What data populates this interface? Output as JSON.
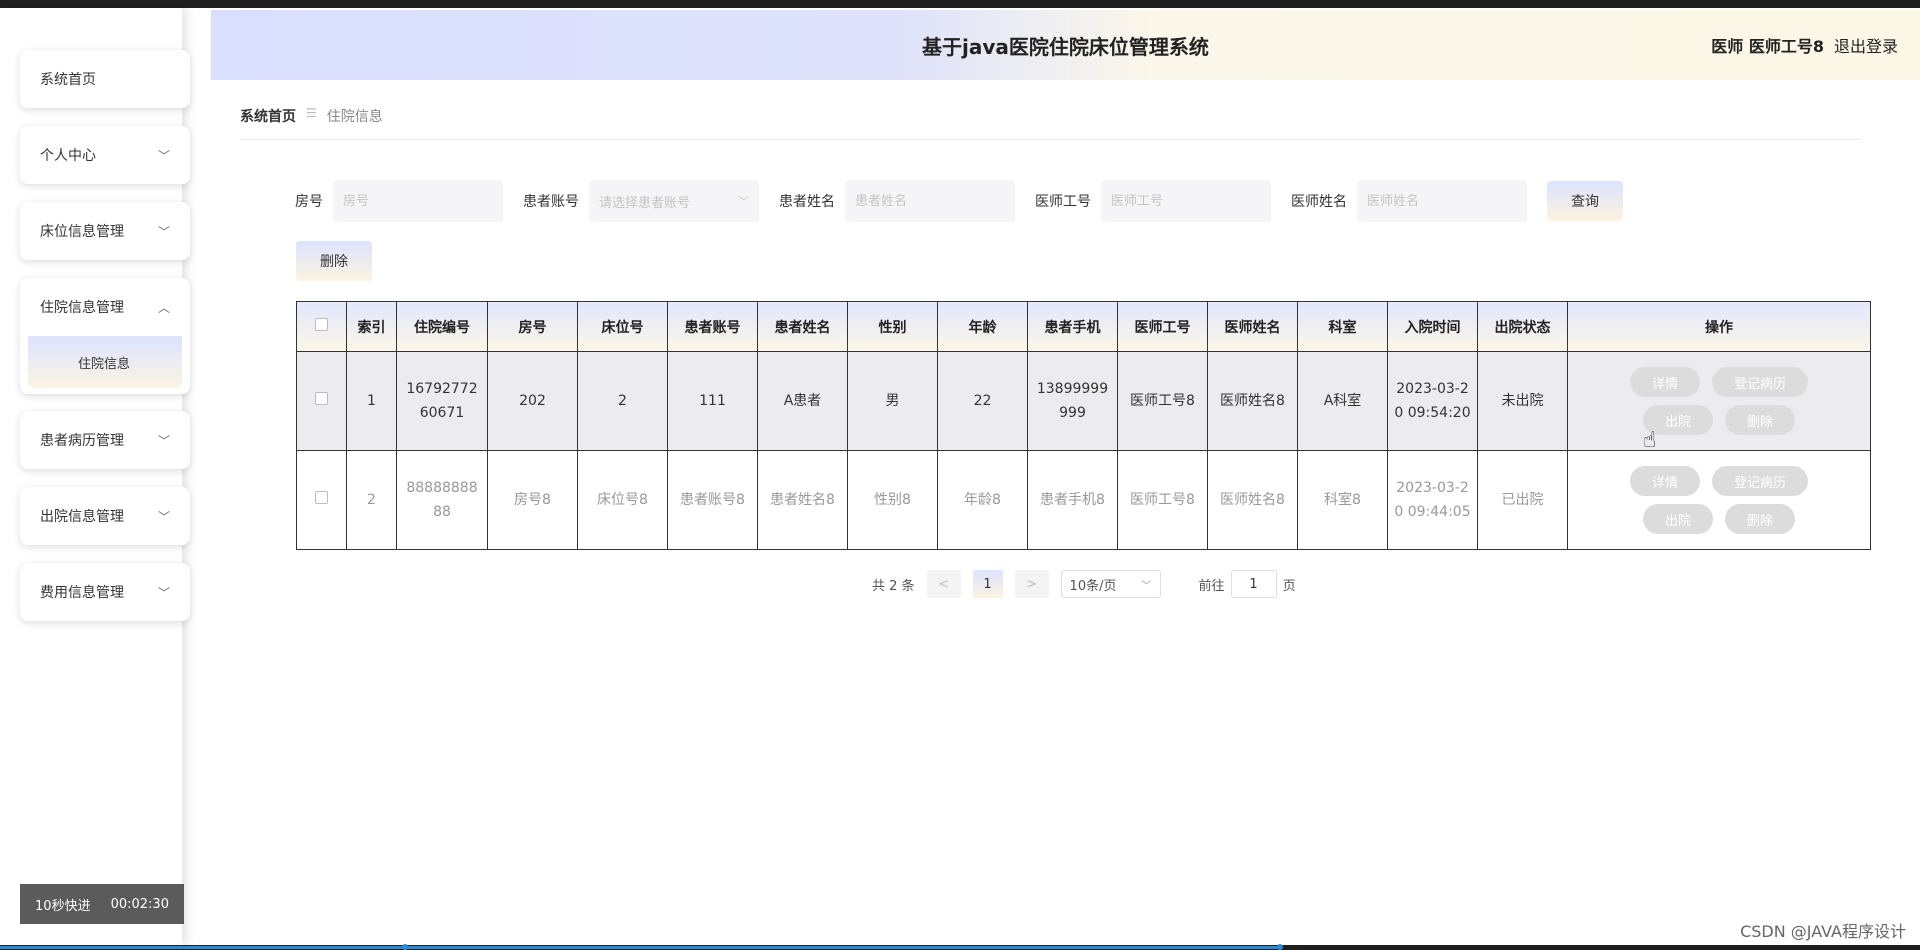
{
  "header": {
    "title": "基于java医院住院床位管理系统",
    "user": "医师 医师工号8",
    "logout": "退出登录"
  },
  "sidebar": {
    "items": [
      {
        "label": "系统首页",
        "icon": "none"
      },
      {
        "label": "个人中心",
        "icon": "chevron-down-icon"
      },
      {
        "label": "床位信息管理",
        "icon": "chevron-down-icon"
      },
      {
        "label": "住院信息管理",
        "icon": "chevron-up-icon",
        "sub": "住院信息"
      },
      {
        "label": "患者病历管理",
        "icon": "chevron-down-icon"
      },
      {
        "label": "出院信息管理",
        "icon": "chevron-down-icon"
      },
      {
        "label": "费用信息管理",
        "icon": "chevron-down-icon"
      }
    ]
  },
  "video": {
    "skip": "10秒快进",
    "time": "00:02:30"
  },
  "breadcrumb": {
    "home": "系统首页",
    "current": "住院信息"
  },
  "search": {
    "room": {
      "label": "房号",
      "placeholder": "房号"
    },
    "account": {
      "label": "患者账号",
      "placeholder": "请选择患者账号"
    },
    "patient_name": {
      "label": "患者姓名",
      "placeholder": "患者姓名"
    },
    "doctor_id": {
      "label": "医师工号",
      "placeholder": "医师工号"
    },
    "doctor_name": {
      "label": "医师姓名",
      "placeholder": "医师姓名"
    },
    "query_button": "查询"
  },
  "delete_button": "删除",
  "table": {
    "headers": [
      "索引",
      "住院编号",
      "房号",
      "床位号",
      "患者账号",
      "患者姓名",
      "性别",
      "年龄",
      "患者手机",
      "医师工号",
      "医师姓名",
      "科室",
      "入院时间",
      "出院状态",
      "操作"
    ],
    "rows": [
      {
        "index": "1",
        "inpatient_no": "1679277260671",
        "room": "202",
        "bed": "2",
        "account": "111",
        "name": "A患者",
        "gender": "男",
        "age": "22",
        "phone": "13899999999",
        "doctor_id": "医师工号8",
        "doctor_name": "医师姓名8",
        "dept": "A科室",
        "admit_time": "2023-03-20 09:54:20",
        "status": "未出院"
      },
      {
        "index": "2",
        "inpatient_no": "8888888888",
        "room": "房号8",
        "bed": "床位号8",
        "account": "患者账号8",
        "name": "患者姓名8",
        "gender": "性别8",
        "age": "年龄8",
        "phone": "患者手机8",
        "doctor_id": "医师工号8",
        "doctor_name": "医师姓名8",
        "dept": "科室8",
        "admit_time": "2023-03-20 09:44:05",
        "status": "已出院"
      }
    ],
    "ops": {
      "detail": "详情",
      "record": "登记病历",
      "discharge": "出院",
      "delete": "删除"
    }
  },
  "pagination": {
    "total": "共 2 条",
    "prev": "<",
    "page": "1",
    "next": ">",
    "size": "10条/页",
    "goto_prefix": "前往",
    "goto_value": "1",
    "goto_suffix": "页"
  },
  "watermark": "CSDN @JAVA程序设计"
}
